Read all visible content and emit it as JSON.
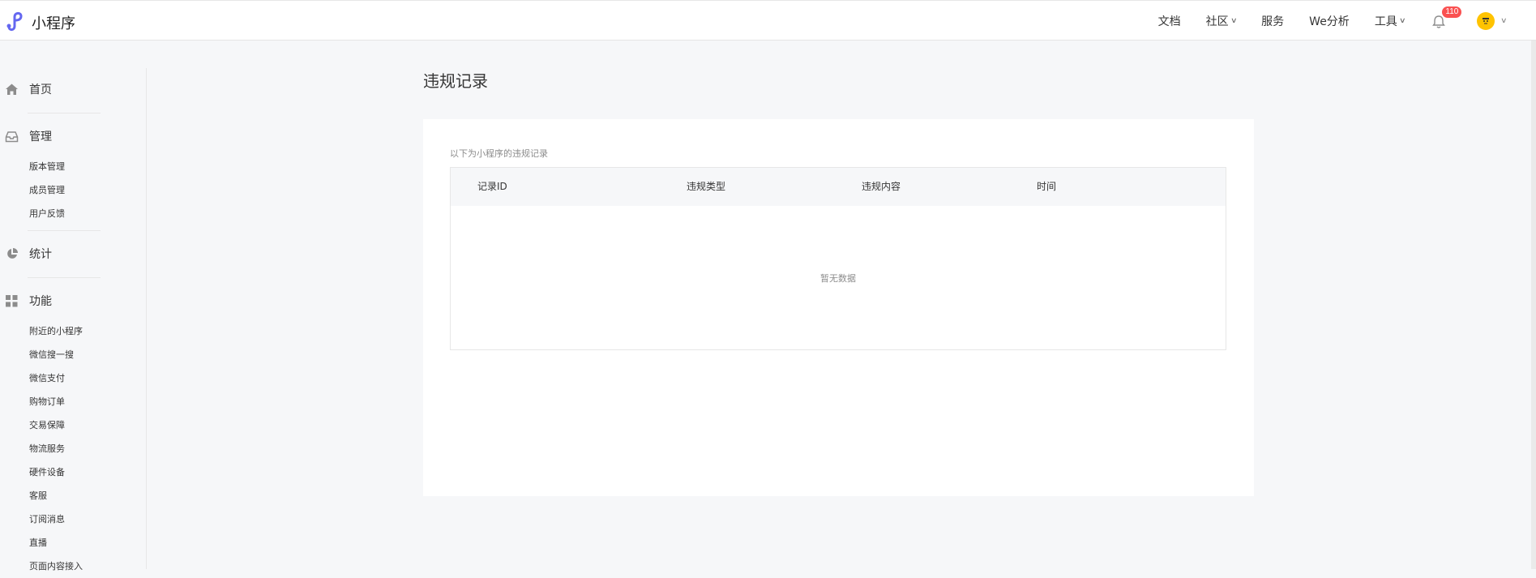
{
  "brand": {
    "name": "小程序"
  },
  "nav": {
    "items": [
      {
        "label": "文档",
        "dropdown": false
      },
      {
        "label": "社区",
        "dropdown": true
      },
      {
        "label": "服务",
        "dropdown": false
      },
      {
        "label": "We分析",
        "dropdown": false
      },
      {
        "label": "工具",
        "dropdown": true
      }
    ],
    "notification_count": "110"
  },
  "sidebar": {
    "home": {
      "label": "首页",
      "icon": "home-icon"
    },
    "manage": {
      "label": "管理",
      "icon": "inbox-icon",
      "items": [
        "版本管理",
        "成员管理",
        "用户反馈"
      ]
    },
    "stats": {
      "label": "统计",
      "icon": "pie-chart-icon"
    },
    "features": {
      "label": "功能",
      "icon": "grid-icon",
      "items": [
        "附近的小程序",
        "微信搜一搜",
        "微信支付",
        "购物订单",
        "交易保障",
        "物流服务",
        "硬件设备",
        "客服",
        "订阅消息",
        "直播",
        "页面内容接入"
      ]
    }
  },
  "main": {
    "title": "违规记录",
    "description": "以下为小程序的违规记录",
    "table": {
      "columns": [
        "记录ID",
        "违规类型",
        "违规内容",
        "时间"
      ],
      "empty_text": "暂无数据"
    }
  },
  "colors": {
    "accent": "#6467f0",
    "badge": "#fa5151",
    "avatar": "#ffc300"
  }
}
